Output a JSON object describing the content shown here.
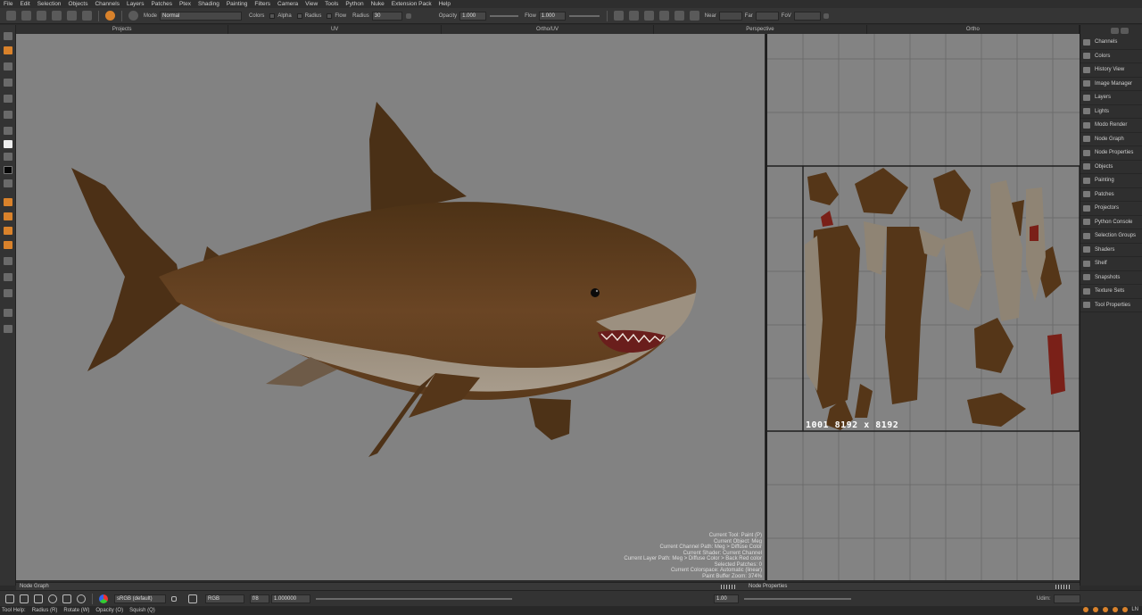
{
  "menu": [
    "File",
    "Edit",
    "Selection",
    "Objects",
    "Channels",
    "Layers",
    "Patches",
    "Ptex",
    "Shading",
    "Painting",
    "Filters",
    "Camera",
    "View",
    "Tools",
    "Python",
    "Nuke",
    "Extension Pack",
    "Help"
  ],
  "toolbar": {
    "mode_label": "Mode",
    "mode_value": "Normal",
    "colors_label": "Colors",
    "alpha_label": "Alpha",
    "radius_chk_label": "Radius",
    "flow_chk_label": "Flow",
    "radius_label": "Radius",
    "radius_value": "30",
    "opacity_label": "Opacity",
    "opacity_value": "1.000",
    "flow_label": "Flow",
    "flow_value": "1.000",
    "near_label": "Near",
    "far_label": "Far",
    "fov_label": "FoV"
  },
  "view_tabs": [
    "Projects",
    "UV",
    "Ortho/UV",
    "Perspective",
    "Ortho"
  ],
  "viewport_info": [
    "Current Tool: Paint (P)",
    "Current Object: Meg",
    "Current Channel Path: Meg > Diffuse Color",
    "Current Shader: Current Channel",
    "Current Layer Path: Meg > Diffuse Color > Back Red color",
    "Selected Patches: 0",
    "Current Colorspace: Automatic (linear)",
    "Paint Buffer Zoom: 374%"
  ],
  "uv_label": "1001 8192 x 8192",
  "right_panel": [
    "Channels",
    "Colors",
    "History View",
    "Image Manager",
    "Layers",
    "Lights",
    "Modo Render",
    "Node Graph",
    "Node Properties",
    "Objects",
    "Painting",
    "Patches",
    "Projectors",
    "Python Console",
    "Selection Groups",
    "Shaders",
    "Shelf",
    "Snapshots",
    "Texture Sets",
    "Tool Properties"
  ],
  "bottom_tabs": {
    "left": "Node Graph",
    "right": "Node Properties"
  },
  "bottom_bar": {
    "colorspace": "sRGB (default)",
    "channel": "RGB",
    "fstop": "f/8",
    "exposure": "1.000000",
    "gamma": "1.00",
    "udim_label": "Udim:"
  },
  "status": {
    "tool_help": "Tool Help:",
    "radius": "Radius (R)",
    "rotate": "Rotate (W)",
    "opacity": "Opacity (O)",
    "squish": "Squish (Q)",
    "mode_letter": "LN"
  }
}
